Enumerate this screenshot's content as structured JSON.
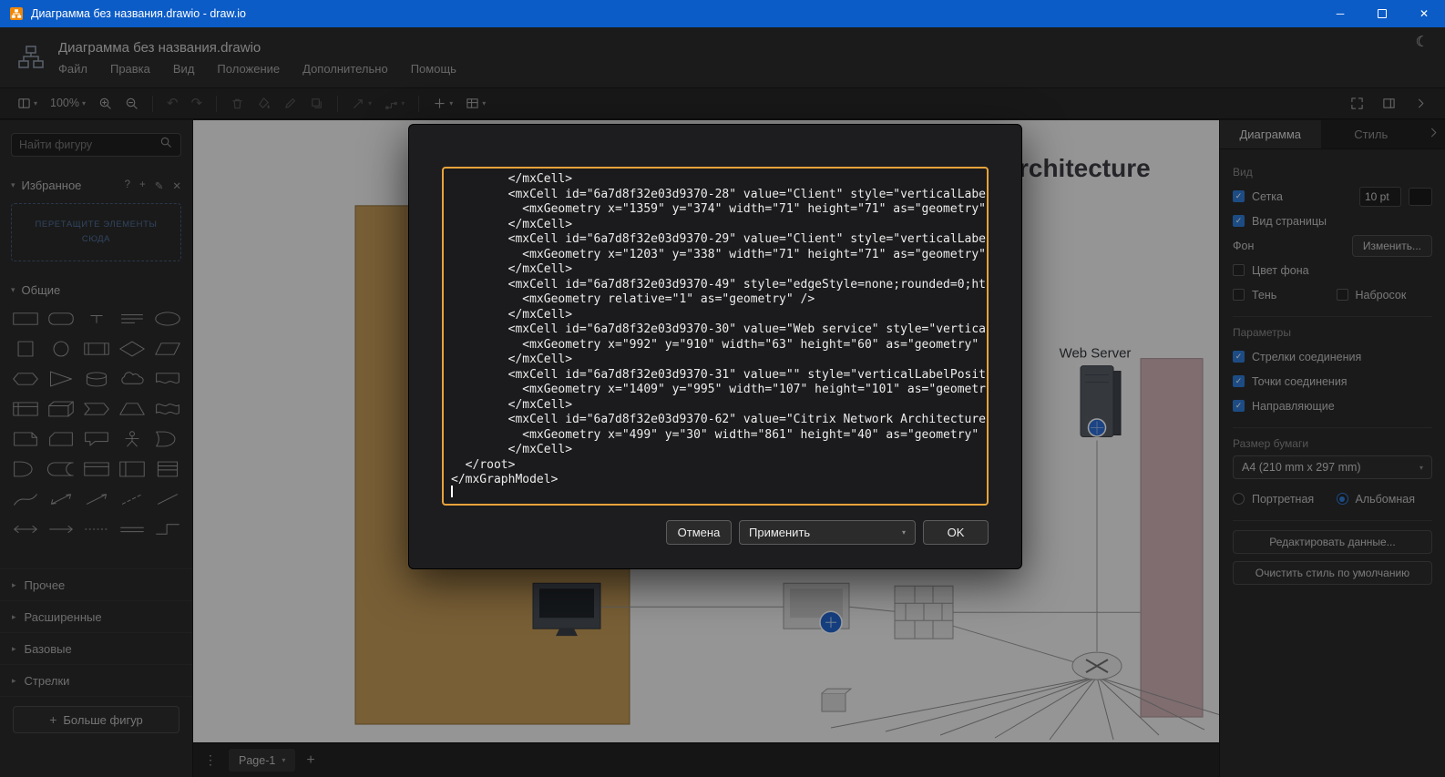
{
  "colors": {
    "titlebar_blue": "#0b5cc7",
    "accent_blue": "#2f7bd6",
    "dialog_border_orange": "#e8a33b",
    "canvas_background": "#f1f1f1"
  },
  "titlebar": {
    "title": "Диаграмма без названия.drawio - draw.io",
    "minimize": "─",
    "close": "✕"
  },
  "header": {
    "document_title": "Диаграмма без названия.drawio",
    "menus": [
      "Файл",
      "Правка",
      "Вид",
      "Положение",
      "Дополнительно",
      "Помощь"
    ]
  },
  "toolbar": {
    "zoom_level": "100%"
  },
  "sidebar": {
    "search_placeholder": "Найти фигуру",
    "favorites": {
      "label": "Избранное",
      "drop_hint": "ПЕРЕТАЩИТЕ ЭЛЕМЕНТЫ СЮДА"
    },
    "shapes_section_label": "Общие",
    "shape_names": [
      "rectangle",
      "rounded-rectangle",
      "text",
      "textbox",
      "ellipse",
      "square",
      "circle",
      "process",
      "diamond",
      "parallelogram",
      "hexagon",
      "triangle",
      "cylinder",
      "cloud",
      "document",
      "internal-storage",
      "cube",
      "step",
      "trapezoid",
      "tape",
      "note",
      "card",
      "callout",
      "actor",
      "or",
      "and",
      "data-storage",
      "container",
      "vertical-container",
      "list",
      "curve",
      "bidirectional-arrow",
      "arrow",
      "dashed-line",
      "line",
      "bidirectional-connector",
      "directional-connector",
      "dotted-line",
      "link",
      "horizontal-elbow"
    ],
    "collapsed_sections": [
      "Прочее",
      "Расширенные",
      "Базовые",
      "Стрелки"
    ],
    "more_shapes_label": "Больше фигур"
  },
  "canvas": {
    "diagram_title": "Citrix Network Architecture",
    "web_server_label": "Web Server"
  },
  "pagebar": {
    "page_tab": "Page-1"
  },
  "format_panel": {
    "tab_diagram": "Диаграмма",
    "tab_style": "Стиль",
    "section_view": "Вид",
    "grid_label": "Сетка",
    "grid_size": "10 pt",
    "page_view_label": "Вид страницы",
    "background_label": "Фон",
    "change_button": "Изменить...",
    "bg_color_label": "Цвет фона",
    "shadow_label": "Тень",
    "sketch_label": "Набросок",
    "section_options": "Параметры",
    "arrows_label": "Стрелки соединения",
    "points_label": "Точки соединения",
    "guides_label": "Направляющие",
    "section_paper": "Размер бумаги",
    "paper_size_value": "A4 (210 mm x 297 mm)",
    "portrait_label": "Портретная",
    "landscape_label": "Альбомная",
    "edit_data_button": "Редактировать данные...",
    "clear_default_style_button": "Очистить стиль по умолчанию"
  },
  "dialog": {
    "xml_lines": [
      "        </mxCell>",
      "        <mxCell id=\"6a7d8f32e03d9370-28\" value=\"Client\" style=\"verticalLabe",
      "          <mxGeometry x=\"1359\" y=\"374\" width=\"71\" height=\"71\" as=\"geometry\"",
      "        </mxCell>",
      "        <mxCell id=\"6a7d8f32e03d9370-29\" value=\"Client\" style=\"verticalLabe",
      "          <mxGeometry x=\"1203\" y=\"338\" width=\"71\" height=\"71\" as=\"geometry\"",
      "        </mxCell>",
      "        <mxCell id=\"6a7d8f32e03d9370-49\" style=\"edgeStyle=none;rounded=0;ht",
      "          <mxGeometry relative=\"1\" as=\"geometry\" />",
      "        </mxCell>",
      "        <mxCell id=\"6a7d8f32e03d9370-30\" value=\"Web service\" style=\"vertica",
      "          <mxGeometry x=\"992\" y=\"910\" width=\"63\" height=\"60\" as=\"geometry\"",
      "        </mxCell>",
      "        <mxCell id=\"6a7d8f32e03d9370-31\" value=\"\" style=\"verticalLabelPosit",
      "          <mxGeometry x=\"1409\" y=\"995\" width=\"107\" height=\"101\" as=\"geometr",
      "        </mxCell>",
      "        <mxCell id=\"6a7d8f32e03d9370-62\" value=\"Citrix Network Architecture",
      "          <mxGeometry x=\"499\" y=\"30\" width=\"861\" height=\"40\" as=\"geometry\"",
      "        </mxCell>",
      "  </root>",
      "</mxGraphModel>"
    ],
    "cancel_label": "Отмена",
    "apply_label": "Применить",
    "ok_label": "OK"
  }
}
